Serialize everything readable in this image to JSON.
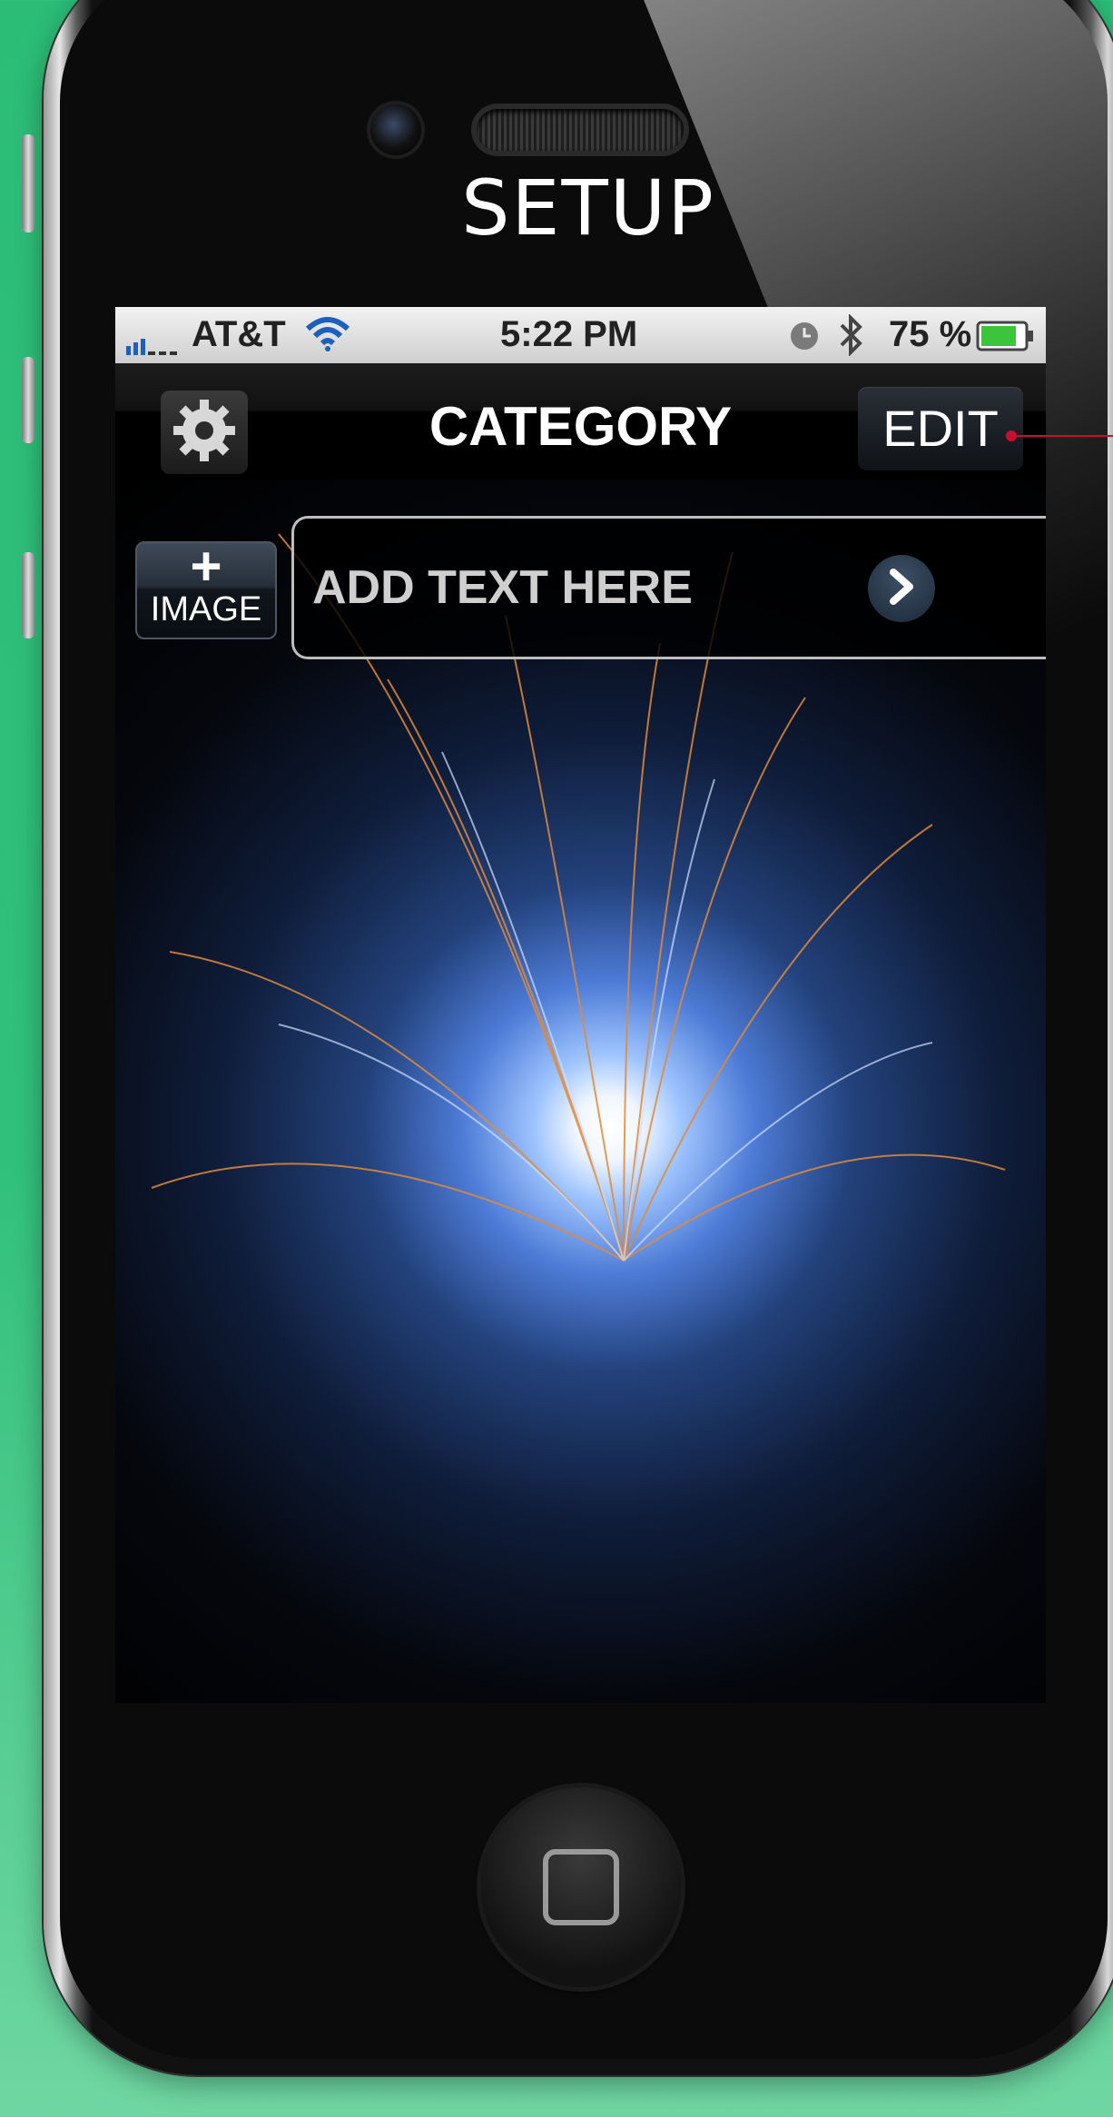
{
  "page": {
    "title": "SETUP"
  },
  "status_bar": {
    "carrier": "AT&T",
    "time": "5:22 PM",
    "battery_percent": "75 %",
    "icons": [
      "signal-bars-icon",
      "wifi-icon",
      "alarm-clock-icon",
      "bluetooth-icon",
      "battery-icon"
    ]
  },
  "nav_bar": {
    "title": "CATEGORY",
    "edit_label": "EDIT",
    "settings_icon": "gear-icon"
  },
  "content": {
    "image_button": {
      "plus": "+",
      "label": "IMAGE"
    },
    "text_cell": {
      "placeholder": "ADD TEXT HERE",
      "disclosure_icon": "chevron-right-icon"
    },
    "background": "welding-sparks-photo"
  },
  "colors": {
    "page_background": "#2bbd76",
    "annotation": "#c8102e",
    "nav_text": "#ffffff"
  }
}
